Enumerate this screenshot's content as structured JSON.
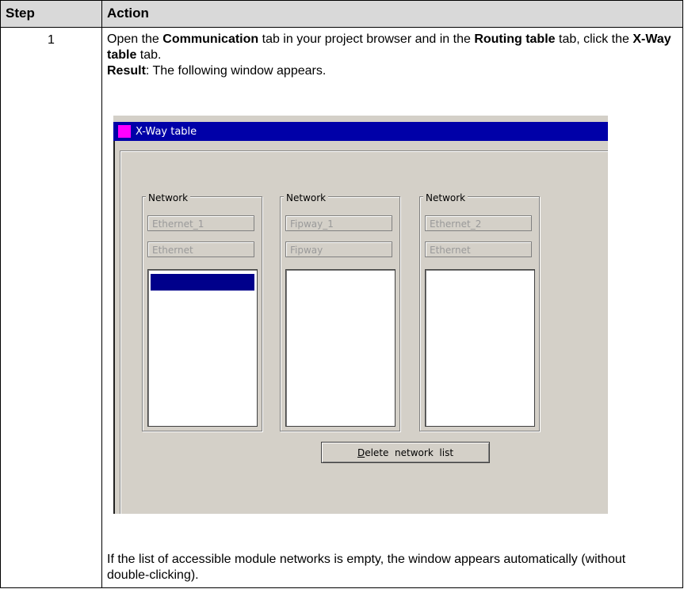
{
  "table": {
    "headers": {
      "step": "Step",
      "action": "Action"
    },
    "row": {
      "step": "1",
      "action": {
        "p1": "Open the ",
        "p1_b1": "Communication",
        "p1_t2": " tab in your project browser and in the ",
        "p1_b2": "Routing table",
        "p1_t3": " tab, click the ",
        "p1_b3": "X-Way table",
        "p1_t4": " tab.",
        "result_label": "Result",
        "result_text": ": The following window appears.",
        "footer": "If the list of accessible module networks is empty, the window appears automatically (without double-clicking)."
      }
    }
  },
  "window": {
    "title": "X-Way table",
    "title_icon": "app-icon",
    "networks": [
      {
        "legend": "Network",
        "name": "Ethernet_1",
        "type": "Ethernet",
        "has_selection": true
      },
      {
        "legend": "Network",
        "name": "Fipway_1",
        "type": "Fipway",
        "has_selection": false
      },
      {
        "legend": "Network",
        "name": "Ethernet_2",
        "type": "Ethernet",
        "has_selection": false
      }
    ],
    "delete_button": {
      "mnemonic": "D",
      "rest": "elete  network  list"
    },
    "colors": {
      "titlebar": "#0000a8",
      "selection": "#00008b",
      "title_icon": "#ff00ff",
      "window_bg": "#d4d0c8",
      "header_bg": "#d9d9d9"
    }
  }
}
